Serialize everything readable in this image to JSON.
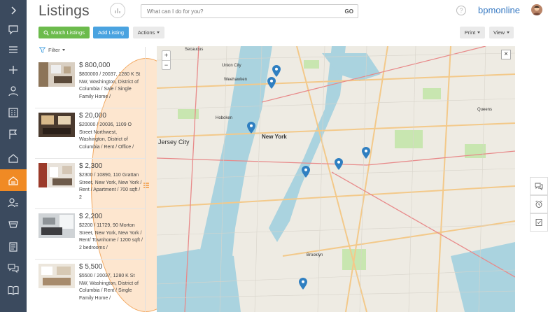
{
  "header": {
    "title": "Listings",
    "search_placeholder": "What can I do for you?",
    "search_go": "GO",
    "brand": "bpmonline",
    "help": "?"
  },
  "toolbar": {
    "match_label": "Match Listings",
    "add_label": "Add Listing",
    "actions_label": "Actions",
    "print_label": "Print",
    "view_label": "View"
  },
  "filter_label": "Filter",
  "listings": [
    {
      "price": "$ 800,000",
      "desc": "$800000 / 20037, 1280 K St NW, Washington, District of Columbia / Sale / Single Family Home /"
    },
    {
      "price": "$ 20,000",
      "desc": "$20000 / 20036, 1109 O Street Northwest, Washington, District of Columbia / Rent / Office /"
    },
    {
      "price": "$ 2,300",
      "desc": "$2300 / 10890, 110 Grattan Street, New York, New York / Rent / Apartment / 700 sqft / 2"
    },
    {
      "price": "$ 2,200",
      "desc": "$2200 / 11729, 90 Morton Street, New York, New York / Rent/ Townhome / 1200 sqft / 2 bedrooms /"
    },
    {
      "price": "$ 5,500",
      "desc": "$5500 / 20037, 1280 K St NW, Washington, District of Columbia / Rent / Single Family Home /"
    }
  ],
  "map": {
    "labels": {
      "new_york": "New York",
      "jersey_city": "Jersey City",
      "hoboken": "Hoboken",
      "brooklyn": "Brooklyn",
      "queens": "Queens",
      "union_city": "Union City",
      "weehawken": "Weehawken",
      "secaucus": "Secaucus"
    },
    "zoom_in": "+",
    "zoom_out": "−",
    "close": "×"
  },
  "colors": {
    "nav_bg": "#3b4a5e",
    "nav_active": "#f08a24",
    "match_green": "#6cbb4c",
    "add_blue": "#4aa3e0",
    "pin_blue": "#2f7fc1"
  }
}
